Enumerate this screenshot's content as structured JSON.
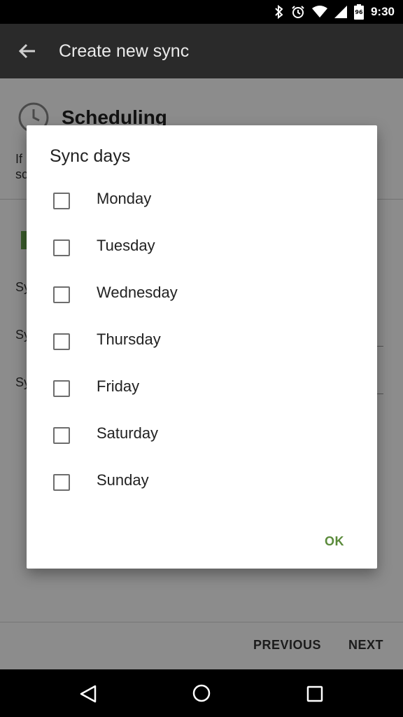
{
  "status_bar": {
    "time": "9:30",
    "battery_level": "96",
    "icons": [
      "bluetooth-icon",
      "alarm-icon",
      "wifi-icon",
      "cell-signal-icon",
      "battery-icon"
    ]
  },
  "app_bar": {
    "title": "Create new sync",
    "back_icon": "arrow-left-icon"
  },
  "background": {
    "section_title": "Scheduling",
    "desc_line1": "If",
    "desc_line2": "sc",
    "rows": [
      {
        "label": "Sy"
      },
      {
        "label": "Sy"
      },
      {
        "label": "Sy"
      }
    ]
  },
  "dialog": {
    "title": "Sync days",
    "options": [
      {
        "label": "Monday",
        "checked": false
      },
      {
        "label": "Tuesday",
        "checked": false
      },
      {
        "label": "Wednesday",
        "checked": false
      },
      {
        "label": "Thursday",
        "checked": false
      },
      {
        "label": "Friday",
        "checked": false
      },
      {
        "label": "Saturday",
        "checked": false
      },
      {
        "label": "Sunday",
        "checked": false
      }
    ],
    "ok_label": "OK"
  },
  "bottom_bar": {
    "previous_label": "PREVIOUS",
    "next_label": "NEXT"
  },
  "colors": {
    "accent": "#5a8a3a",
    "app_bar": "#2a2a2a",
    "status_bar": "#000000"
  }
}
